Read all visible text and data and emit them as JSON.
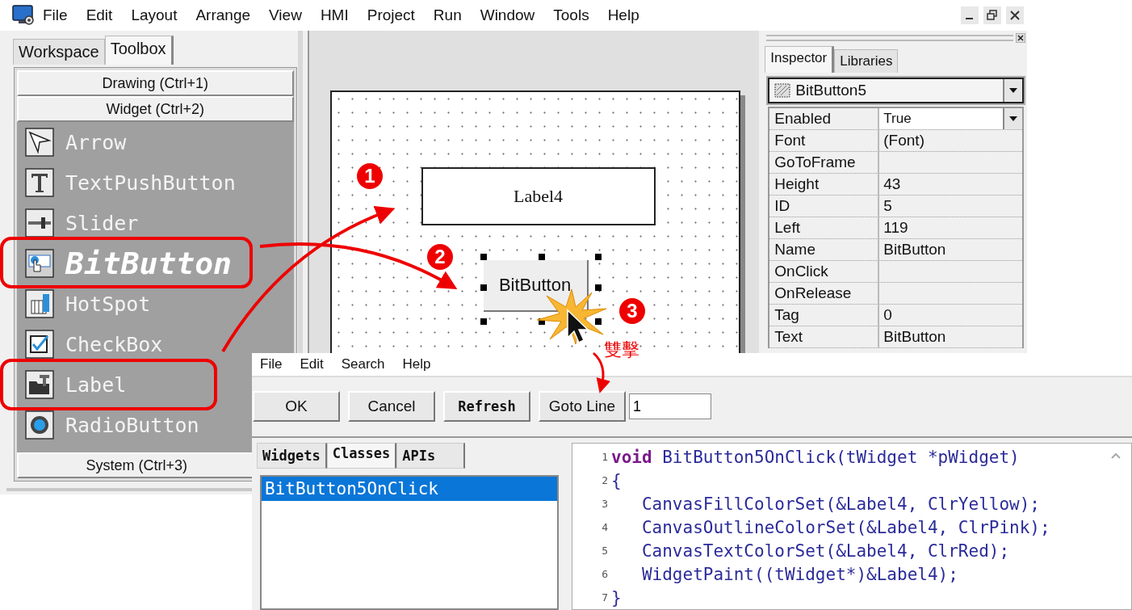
{
  "main_window": {
    "menu": [
      "File",
      "Edit",
      "Layout",
      "Arrange",
      "View",
      "HMI",
      "Project",
      "Run",
      "Window",
      "Tools",
      "Help"
    ]
  },
  "left_panel": {
    "tabs": [
      {
        "label": "Workspace",
        "selected": false
      },
      {
        "label": "Toolbox",
        "selected": true
      }
    ],
    "groups": [
      "Drawing (Ctrl+1)",
      "Widget (Ctrl+2)"
    ],
    "items": [
      {
        "label": "Arrow",
        "selected": false
      },
      {
        "label": "TextPushButton",
        "selected": false
      },
      {
        "label": "Slider",
        "selected": false
      },
      {
        "label": "BitButton",
        "selected": true
      },
      {
        "label": "HotSpot",
        "selected": false
      },
      {
        "label": "CheckBox",
        "selected": false
      },
      {
        "label": "Label",
        "selected": false
      },
      {
        "label": "RadioButton",
        "selected": false
      }
    ],
    "footer_group": "System (Ctrl+3)"
  },
  "canvas": {
    "label_widget": "Label4",
    "button_widget": "BitButton",
    "button_selected": true
  },
  "inspector": {
    "tabs": [
      {
        "label": "Inspector",
        "selected": true
      },
      {
        "label": "Libraries",
        "selected": false
      }
    ],
    "object": "BitButton5",
    "properties": [
      {
        "name": "Enabled",
        "value": "True",
        "kind": "dropdown"
      },
      {
        "name": "Font",
        "value": "(Font)",
        "kind": "text"
      },
      {
        "name": "GoToFrame",
        "kind": "text"
      },
      {
        "name": "Height",
        "value": "43",
        "kind": "text"
      },
      {
        "name": "ID",
        "value": "5",
        "kind": "text"
      },
      {
        "name": "Left",
        "value": "119",
        "kind": "text"
      },
      {
        "name": "Name",
        "value": "BitButton",
        "kind": "text"
      },
      {
        "name": "OnClick",
        "kind": "text"
      },
      {
        "name": "OnRelease",
        "kind": "text"
      },
      {
        "name": "Tag",
        "value": "0",
        "kind": "text"
      },
      {
        "name": "Text",
        "value": "BitButton",
        "kind": "text"
      }
    ]
  },
  "code_dialog": {
    "menu": [
      "File",
      "Edit",
      "Search",
      "Help"
    ],
    "buttons": [
      {
        "label": "OK",
        "kind": "normal"
      },
      {
        "label": "Cancel",
        "kind": "normal"
      },
      {
        "label": "Refresh",
        "kind": "bold"
      },
      {
        "label": "Goto Line",
        "kind": "normal"
      }
    ],
    "line_field": "1",
    "tabs": [
      {
        "label": "Widgets",
        "selected": false
      },
      {
        "label": "Classes",
        "selected": true
      },
      {
        "label": "APIs",
        "selected": false
      }
    ],
    "list": [
      {
        "label": "BitButton5OnClick",
        "selected": true
      }
    ],
    "code": [
      {
        "num": "1",
        "tokens": [
          {
            "kind": "keyword",
            "text": "void"
          },
          {
            "kind": "plain",
            "text": " BitButton5OnClick(tWidget *pWidget)"
          }
        ]
      },
      {
        "num": "2",
        "tokens": [
          {
            "kind": "plain",
            "text": "{"
          }
        ]
      },
      {
        "num": "3",
        "tokens": [
          {
            "kind": "plain",
            "text": "   CanvasFillColorSet(&Label4, ClrYellow);"
          }
        ]
      },
      {
        "num": "4",
        "tokens": [
          {
            "kind": "plain",
            "text": "   CanvasOutlineColorSet(&Label4, ClrPink);"
          }
        ]
      },
      {
        "num": "5",
        "tokens": [
          {
            "kind": "plain",
            "text": "   CanvasTextColorSet(&Label4, ClrRed);"
          }
        ]
      },
      {
        "num": "6",
        "tokens": [
          {
            "kind": "plain",
            "text": "   WidgetPaint((tWidget*)&Label4);"
          }
        ]
      },
      {
        "num": "7",
        "tokens": [
          {
            "kind": "plain",
            "text": "}"
          }
        ]
      }
    ]
  },
  "annotations": {
    "steps": [
      "1",
      "2",
      "3"
    ],
    "note": "雙擊"
  }
}
